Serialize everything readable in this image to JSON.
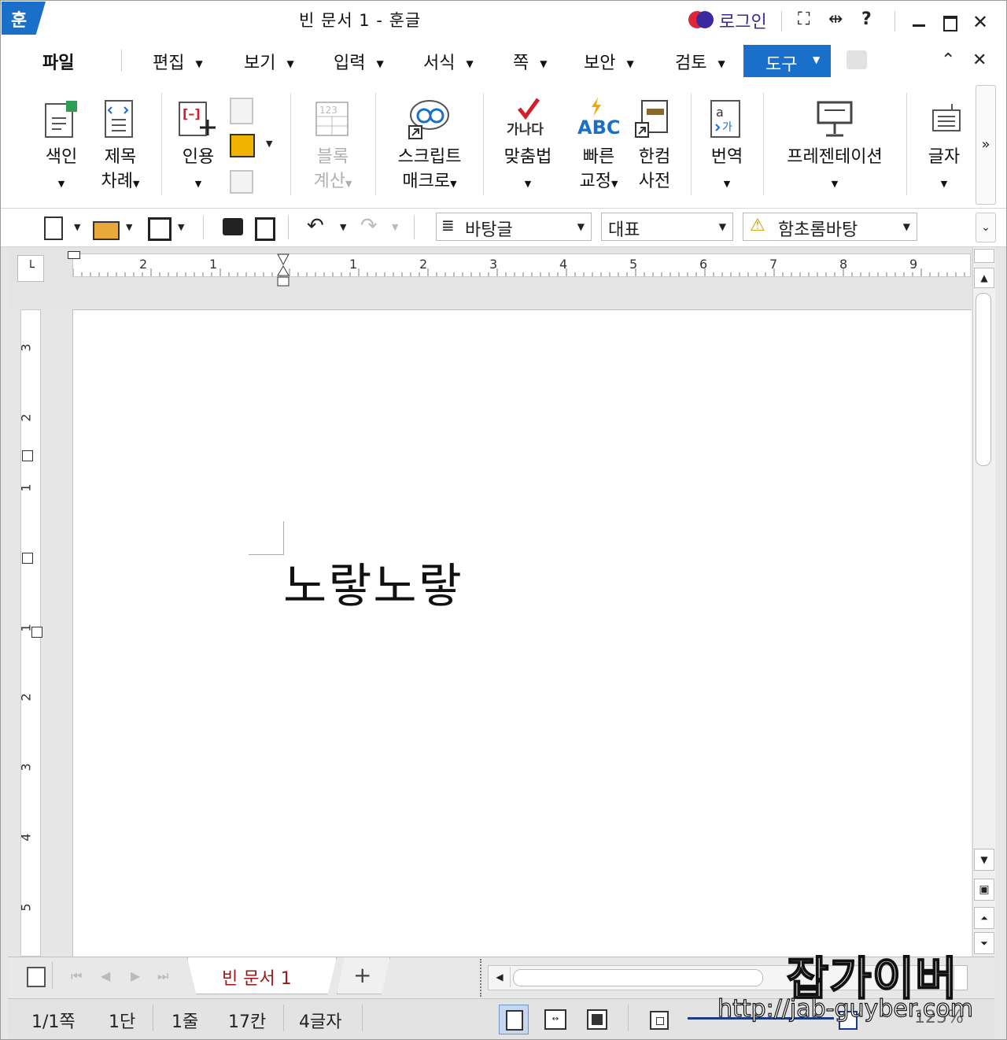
{
  "window": {
    "title": "빈 문서 1 - 훈글",
    "logo": "훈",
    "login": "로그인"
  },
  "title_icons": [
    "fullscreen-icon",
    "resize-icon",
    "help-icon",
    "minimize-icon",
    "maximize-icon",
    "close-icon"
  ],
  "menu": {
    "file": "파일",
    "items": [
      "편집",
      "보기",
      "입력",
      "서식",
      "쪽",
      "보안",
      "검토"
    ],
    "active": "도구"
  },
  "ribbon": {
    "index": [
      "색인"
    ],
    "toc": [
      "제목",
      "차례"
    ],
    "cite": "인용",
    "block_calc": [
      "블록",
      "계산"
    ],
    "script_macro": [
      "스크립트",
      "매크로"
    ],
    "spellcheck": "맞춤법",
    "spellcheck_icon": "가나다",
    "quick_correct": [
      "빠른",
      "교정"
    ],
    "quick_correct_icon": "ABC",
    "hancom_dict": [
      "한컴",
      "사전"
    ],
    "translate": "번역",
    "presentation": "프레젠테이션",
    "char": "글자"
  },
  "toolbar": {
    "style": "바탕글",
    "font_lang": "대표",
    "font": "함초롬바탕"
  },
  "ruler": {
    "horizontal": [
      "2",
      "1",
      "1",
      "2",
      "3",
      "4",
      "5",
      "6",
      "7",
      "8",
      "9"
    ],
    "vertical": [
      "3",
      "2",
      "1",
      "1",
      "2",
      "3",
      "4",
      "5"
    ]
  },
  "document": {
    "text": "노랗노랗"
  },
  "tabs": {
    "doc_tab": "빈 문서 1",
    "add": "+"
  },
  "status": {
    "page": "1/1쪽",
    "column": "1단",
    "line": "1줄",
    "col_pos": "17칸",
    "chars": "4글자",
    "zoom": "125%"
  },
  "watermark": {
    "big": "잡가이버",
    "url": "http://jab-guyber.com"
  },
  "colors": {
    "accent": "#1a6fc9",
    "tab_text": "#a01515",
    "login": "#3a2a9a"
  }
}
